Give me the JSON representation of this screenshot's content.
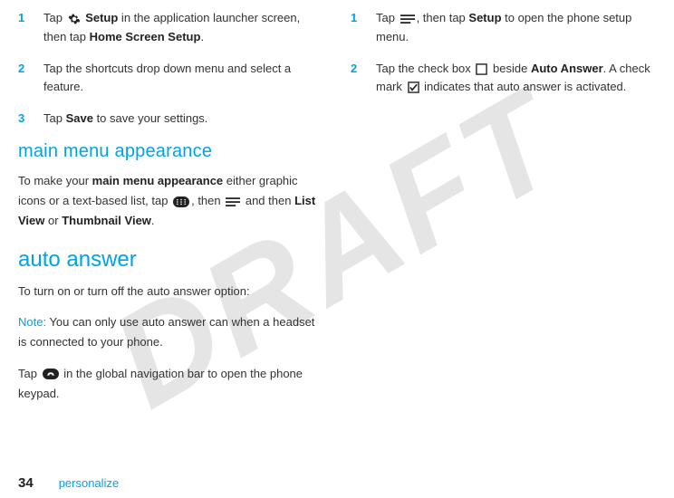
{
  "watermark": "DRAFT",
  "left": {
    "steps_a": [
      {
        "num": "1",
        "pre": "Tap ",
        "icon": "gear",
        "bold1": " Setup",
        "mid": " in the application launcher screen, then tap ",
        "bold2": "Home Screen Setup",
        "post": "."
      },
      {
        "num": "2",
        "text": "Tap the shortcuts drop down menu and select a feature."
      },
      {
        "num": "3",
        "pre": "Tap ",
        "bold1": "Save",
        "post": " to save your settings."
      }
    ],
    "h2": "main menu appearance",
    "mma": {
      "pre": "To make your ",
      "bold_serif": "main menu appearance",
      "mid1": " either graphic icons or a text-based list, tap ",
      "icon1": "grid",
      "mid2": ", then ",
      "icon2": "menu",
      "mid3": " and then ",
      "bold_cond1": "List View",
      "or": " or ",
      "bold_cond2": "Thumbnail View",
      "post": "."
    },
    "h1": "auto answer",
    "intro": "To turn on or turn off the auto answer option:",
    "note_label": "Note:",
    "note_text": " You can only use auto answer can when a headset is connected to your phone.",
    "tap_phone": {
      "pre": "Tap ",
      "icon": "phone",
      "post": " in the global navigation bar to open the phone keypad."
    }
  },
  "right": {
    "steps": [
      {
        "num": "1",
        "pre": "Tap ",
        "icon": "menu",
        "mid": ", then tap ",
        "bold1": "Setup",
        "post": " to open the phone setup menu."
      },
      {
        "num": "2",
        "pre": "Tap the check box ",
        "icon1": "box",
        "mid1": " beside ",
        "bold1": "Auto Answer",
        "mid2": ". A check mark ",
        "icon2": "check",
        "post": " indicates that auto answer is activated."
      }
    ]
  },
  "footer": {
    "page": "34",
    "section": "personalize"
  }
}
